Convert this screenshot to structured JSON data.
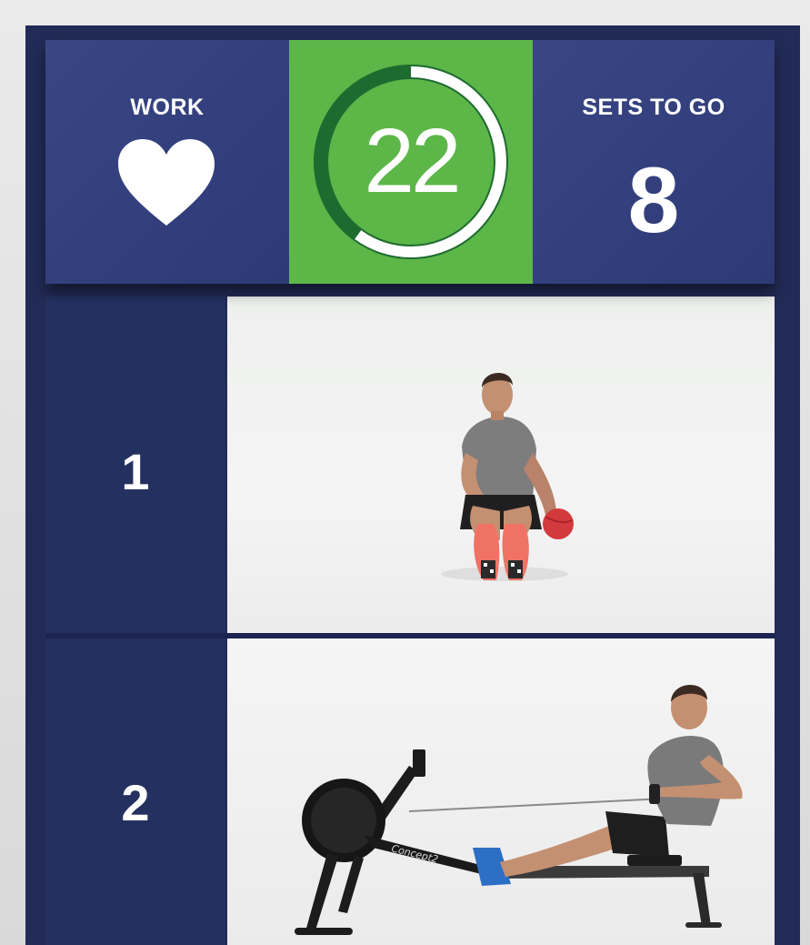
{
  "header": {
    "work_label": "WORK",
    "timer_value": "22",
    "timer_progress": 0.6,
    "sets_label": "SETS TO GO",
    "sets_value": "8"
  },
  "exercises": [
    {
      "number": "1",
      "image": "seated-russian-twist-medicine-ball"
    },
    {
      "number": "2",
      "image": "rowing-machine"
    }
  ],
  "rowing_machine_brand": "Concept2",
  "colors": {
    "panel_blue": "#34407b",
    "background_navy": "#222b57",
    "timer_green": "#5cb648",
    "ring_dark_green": "#1e6b2f",
    "text_white": "#ffffff"
  },
  "icons": {
    "work": "heart-icon"
  }
}
